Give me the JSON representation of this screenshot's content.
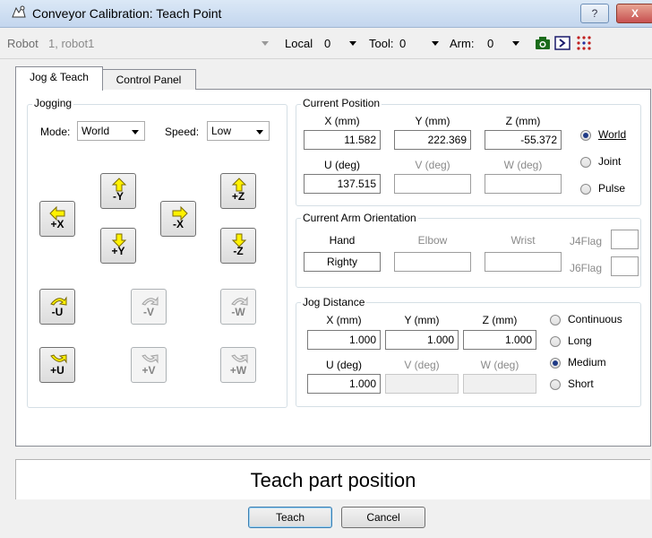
{
  "window": {
    "title": "Conveyor Calibration: Teach Point",
    "help_label": "?",
    "close_label": "X"
  },
  "toolbar": {
    "robot_label": "Robot",
    "robot_value": "1, robot1",
    "local_label": "Local",
    "local_value": "0",
    "tool_label": "Tool:",
    "tool_value": "0",
    "arm_label": "Arm:",
    "arm_value": "0",
    "icons": [
      "camera-icon",
      "command-prompt-icon",
      "io-dots-icon"
    ]
  },
  "tabs": [
    {
      "label": "Jog & Teach",
      "selected": true
    },
    {
      "label": "Control Panel",
      "selected": false
    }
  ],
  "jogging": {
    "group_label": "Jogging",
    "mode_label": "Mode:",
    "mode_value": "World",
    "speed_label": "Speed:",
    "speed_value": "Low",
    "buttons": {
      "minus_y": "-Y",
      "plus_z": "+Z",
      "plus_x": "+X",
      "minus_x": "-X",
      "plus_y": "+Y",
      "minus_z": "-Z",
      "minus_u": "-U",
      "minus_v": "-V",
      "minus_w": "-W",
      "plus_u": "+U",
      "plus_v": "+V",
      "plus_w": "+W"
    },
    "colors": {
      "arrow": "#fff200",
      "arrow_outline": "#7a6a00"
    }
  },
  "current_position": {
    "group_label": "Current Position",
    "x_label": "X (mm)",
    "y_label": "Y (mm)",
    "z_label": "Z (mm)",
    "u_label": "U (deg)",
    "v_label": "V (deg)",
    "w_label": "W (deg)",
    "x": "11.582",
    "y": "222.369",
    "z": "-55.372",
    "u": "137.515",
    "v": "",
    "w": "",
    "modes": [
      {
        "label": "World",
        "selected": true
      },
      {
        "label": "Joint",
        "selected": false
      },
      {
        "label": "Pulse",
        "selected": false
      }
    ]
  },
  "orientation": {
    "group_label": "Current Arm Orientation",
    "hand_label": "Hand",
    "elbow_label": "Elbow",
    "wrist_label": "Wrist",
    "hand_value": "Righty",
    "elbow_value": "",
    "wrist_value": "",
    "j4flag_label": "J4Flag",
    "j6flag_label": "J6Flag"
  },
  "jog_distance": {
    "group_label": "Jog Distance",
    "x_label": "X (mm)",
    "y_label": "Y (mm)",
    "z_label": "Z (mm)",
    "u_label": "U (deg)",
    "v_label": "V (deg)",
    "w_label": "W (deg)",
    "x": "1.000",
    "y": "1.000",
    "z": "1.000",
    "u": "1.000",
    "v": "",
    "w": "",
    "options": [
      {
        "label": "Continuous",
        "selected": false
      },
      {
        "label": "Long",
        "selected": false
      },
      {
        "label": "Medium",
        "selected": true
      },
      {
        "label": "Short",
        "selected": false
      }
    ]
  },
  "status": {
    "text": "Teach part position"
  },
  "buttons": {
    "teach": "Teach",
    "cancel": "Cancel"
  }
}
